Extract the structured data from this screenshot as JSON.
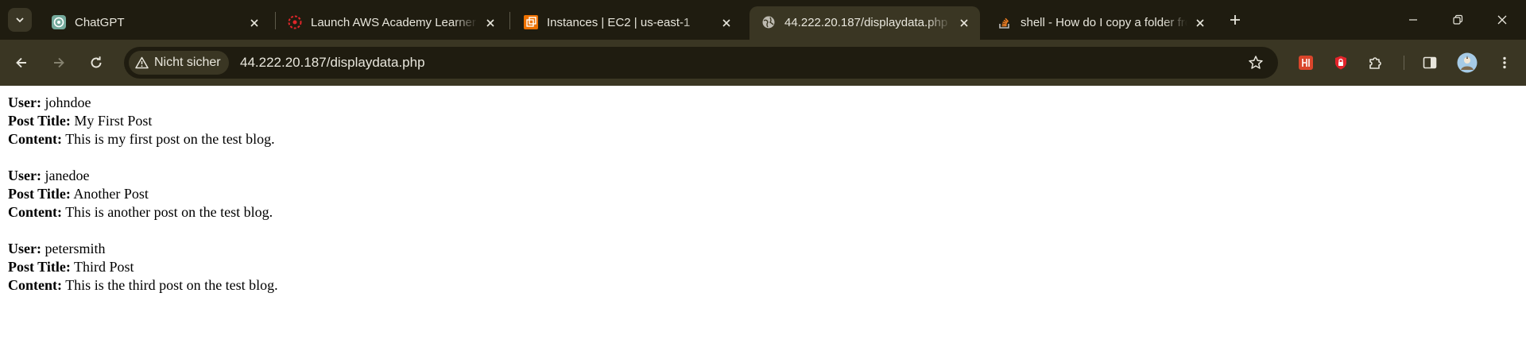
{
  "browser": {
    "tabs": [
      {
        "title": "ChatGPT",
        "icon": "chatgpt-icon",
        "active": false
      },
      {
        "title": "Launch AWS Academy Learner Lab",
        "icon": "aws-academy-icon",
        "active": false
      },
      {
        "title": "Instances | EC2 | us-east-1",
        "icon": "ec2-icon",
        "active": false
      },
      {
        "title": "44.222.20.187/displaydata.php",
        "icon": "globe-icon",
        "active": true
      },
      {
        "title": "shell - How do I copy a folder from",
        "icon": "stackoverflow-icon",
        "active": false
      }
    ],
    "security_label": "Nicht sicher",
    "url": "44.222.20.187/displaydata.php"
  },
  "page": {
    "labels": {
      "user": "User:",
      "title": "Post Title:",
      "content": "Content:"
    },
    "posts": [
      {
        "user": "johndoe",
        "title": "My First Post",
        "content": "This is my first post on the test blog."
      },
      {
        "user": "janedoe",
        "title": "Another Post",
        "content": "This is another post on the test blog."
      },
      {
        "user": "petersmith",
        "title": "Third Post",
        "content": "This is the third post on the test blog."
      }
    ]
  },
  "colors": {
    "tabstrip": "#1f1c10",
    "toolbar": "#3a3623",
    "text_light": "#e8e6dc"
  }
}
